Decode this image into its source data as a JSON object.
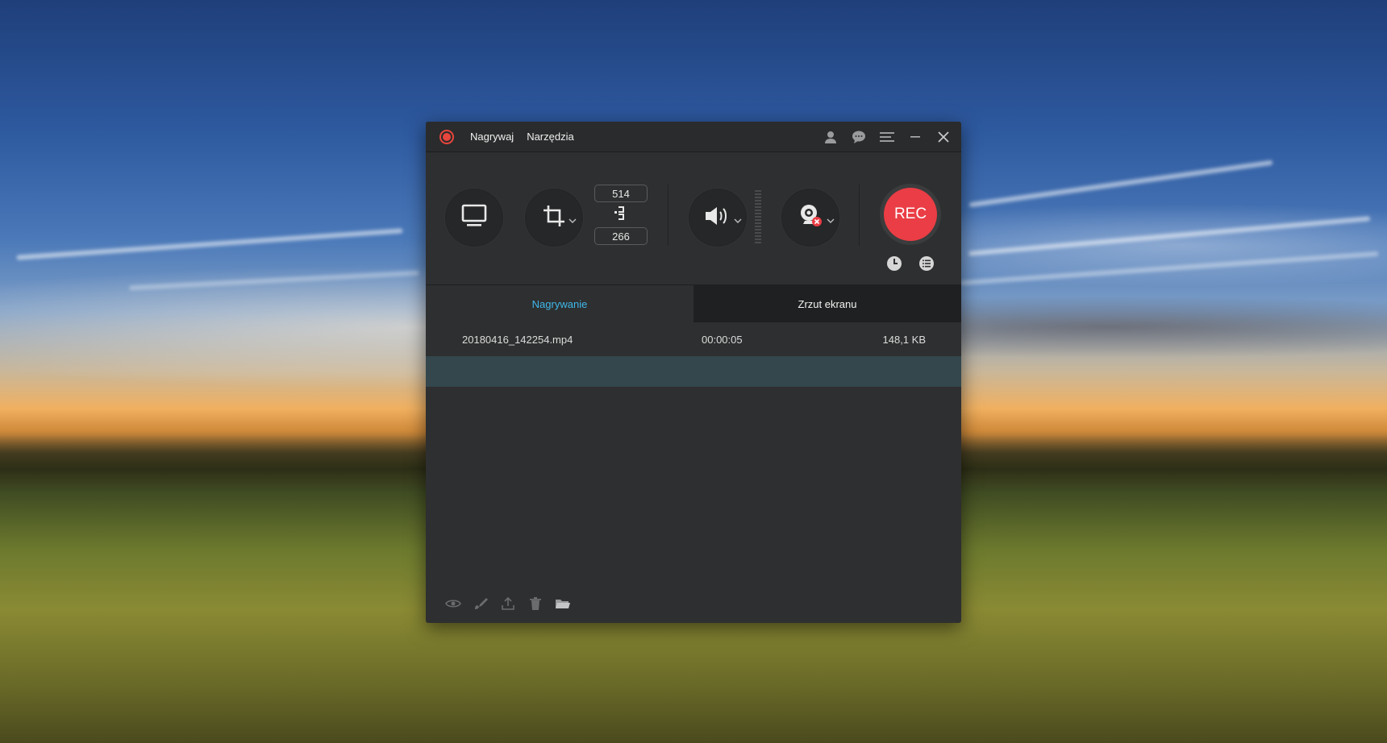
{
  "titlebar": {
    "menu": [
      "Nagrywaj",
      "Narzędzia"
    ],
    "icons": [
      "account-icon",
      "feedback-icon",
      "menu-icon",
      "minimize-icon",
      "close-icon"
    ]
  },
  "toolbar": {
    "width_value": "514",
    "height_value": "266",
    "rec_label": "REC"
  },
  "tabs": [
    {
      "label": "Nagrywanie",
      "active": true
    },
    {
      "label": "Zrzut ekranu",
      "active": false
    }
  ],
  "files": [
    {
      "name": "20180416_142254.mp4",
      "duration": "00:00:05",
      "size": "148,1 KB"
    }
  ],
  "colors": {
    "accent": "#3fb8ea",
    "rec": "#ea3d45",
    "window_bg": "#2e2f30",
    "selected_row": "#33474d"
  }
}
